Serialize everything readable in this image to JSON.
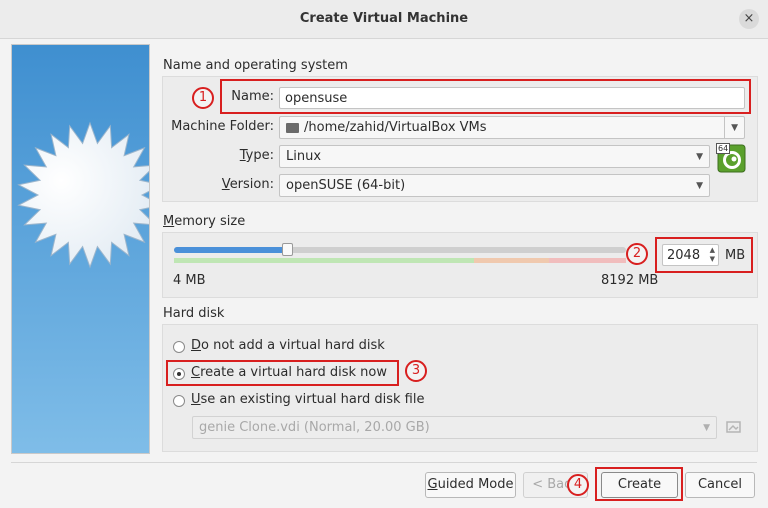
{
  "window": {
    "title": "Create Virtual Machine",
    "close_glyph": "×"
  },
  "name_os": {
    "section_label": "Name and operating system",
    "name_label": "Name:",
    "name_value": "opensuse",
    "folder_label": "Machine Folder:",
    "folder_value": "/home/zahid/VirtualBox VMs",
    "type_label_u": "T",
    "type_label_rest": "ype:",
    "type_value": "Linux",
    "version_label_u": "V",
    "version_label_rest": "ersion:",
    "version_value": "openSUSE (64-bit)",
    "os_badge": "64"
  },
  "memory": {
    "section_label_u": "M",
    "section_label_rest": "emory size",
    "min_label": "4 MB",
    "max_label": "8192 MB",
    "value": "2048",
    "unit": "MB",
    "slider_fraction": 0.25
  },
  "hard_disk": {
    "section_label": "Hard disk",
    "options": [
      {
        "u": "D",
        "rest": "o not add a virtual hard disk",
        "selected": false
      },
      {
        "u": "C",
        "rest": "reate a virtual hard disk now",
        "selected": true
      },
      {
        "u": "U",
        "rest": "se an existing virtual hard disk file",
        "selected": false
      }
    ],
    "existing_file": "genie Clone.vdi (Normal, 20.00 GB)"
  },
  "buttons": {
    "guided_u": "G",
    "guided_rest": "uided Mode",
    "back": "< Back",
    "create": "Create",
    "cancel": "Cancel"
  },
  "annotations": [
    "1",
    "2",
    "3",
    "4"
  ],
  "colors": {
    "annotation_red": "#d81f1f",
    "slider_fill": "#4a90d9"
  }
}
